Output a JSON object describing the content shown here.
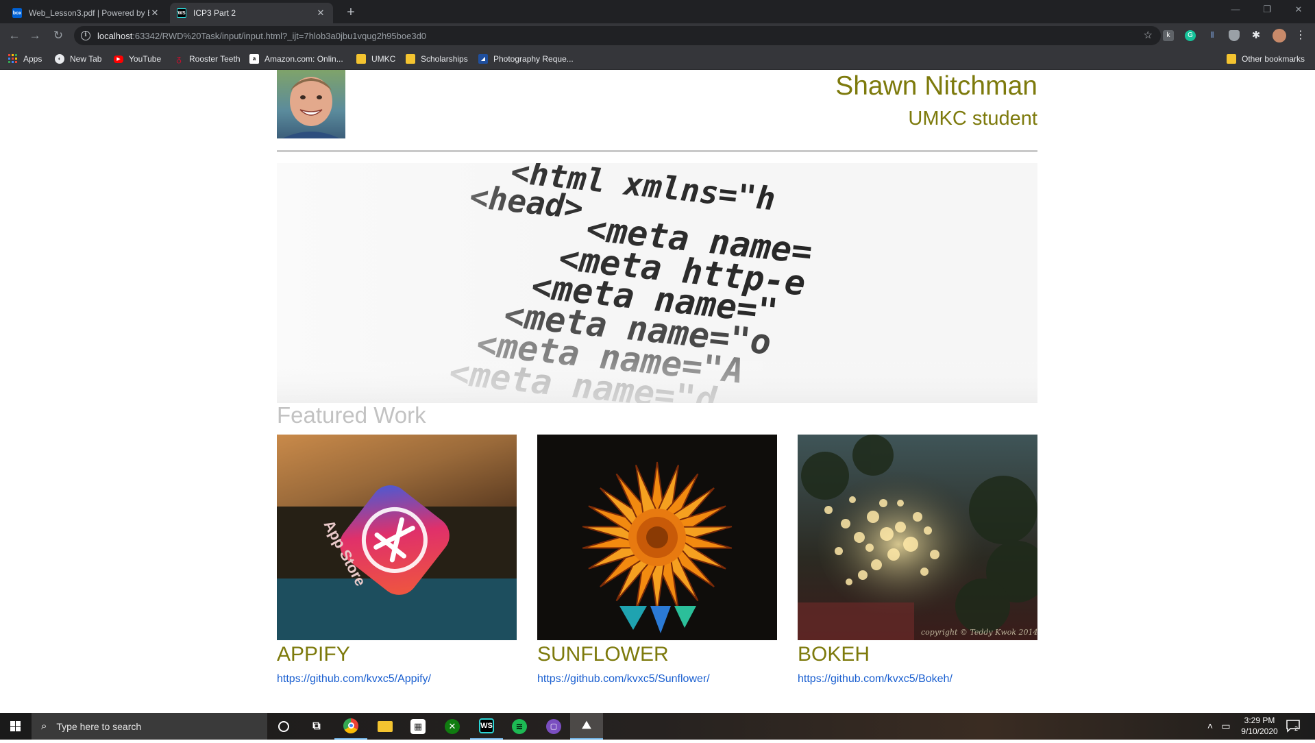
{
  "browser": {
    "tabs": [
      {
        "title": "Web_Lesson3.pdf | Powered by B",
        "favicon": "box-icon",
        "active": false
      },
      {
        "title": "ICP3 Part 2",
        "favicon": "webstorm-icon",
        "active": true
      }
    ],
    "url_host": "localhost",
    "url_rest": ":63342/RWD%20Task/input/input.html?_ijt=7hlob3a0jbu1vqug2h95boe3d0",
    "bookmarks": [
      {
        "label": "Apps",
        "icon": "apps-grid-icon"
      },
      {
        "label": "New Tab",
        "icon": "globe-icon"
      },
      {
        "label": "YouTube",
        "icon": "youtube-icon"
      },
      {
        "label": "Rooster Teeth",
        "icon": "rooster-teeth-icon"
      },
      {
        "label": "Amazon.com: Onlin...",
        "icon": "amazon-icon"
      },
      {
        "label": "UMKC",
        "icon": "folder-icon"
      },
      {
        "label": "Scholarships",
        "icon": "folder-icon"
      },
      {
        "label": "Photography Reque...",
        "icon": "site-icon"
      }
    ],
    "other_bookmarks": "Other bookmarks"
  },
  "page": {
    "name": "Shawn Nitchman",
    "subtitle": "UMKC student",
    "featured_heading": "Featured Work",
    "projects": [
      {
        "title": "APPIFY",
        "link": "https://github.com/kvxc5/Appify/",
        "image": "app-store-photo"
      },
      {
        "title": "SUNFLOWER",
        "link": "https://github.com/kvxc5/Sunflower/",
        "image": "sunflower-photo"
      },
      {
        "title": "BOKEH",
        "link": "https://github.com/kvxc5/Bokeh/",
        "image": "bokeh-photo"
      }
    ],
    "hero_code_lines": [
      "<html xmlns=\"h",
      "<head>",
      "<meta name=",
      "<meta http-e",
      "<meta name=\"",
      "<meta name=\"o",
      "<meta name=\"A",
      "<meta name=\"d"
    ],
    "bokeh_copyright": "copyright © Teddy Kwok 2014",
    "appify_overlay_text": "App Store"
  },
  "taskbar": {
    "search_placeholder": "Type here to search",
    "time": "3:29 PM",
    "date": "9/10/2020",
    "notification_count": "2"
  },
  "colors": {
    "olive_accent": "#7d7a0c",
    "featured_gray": "#c2c2c2",
    "link_blue": "#1a5fd0"
  }
}
